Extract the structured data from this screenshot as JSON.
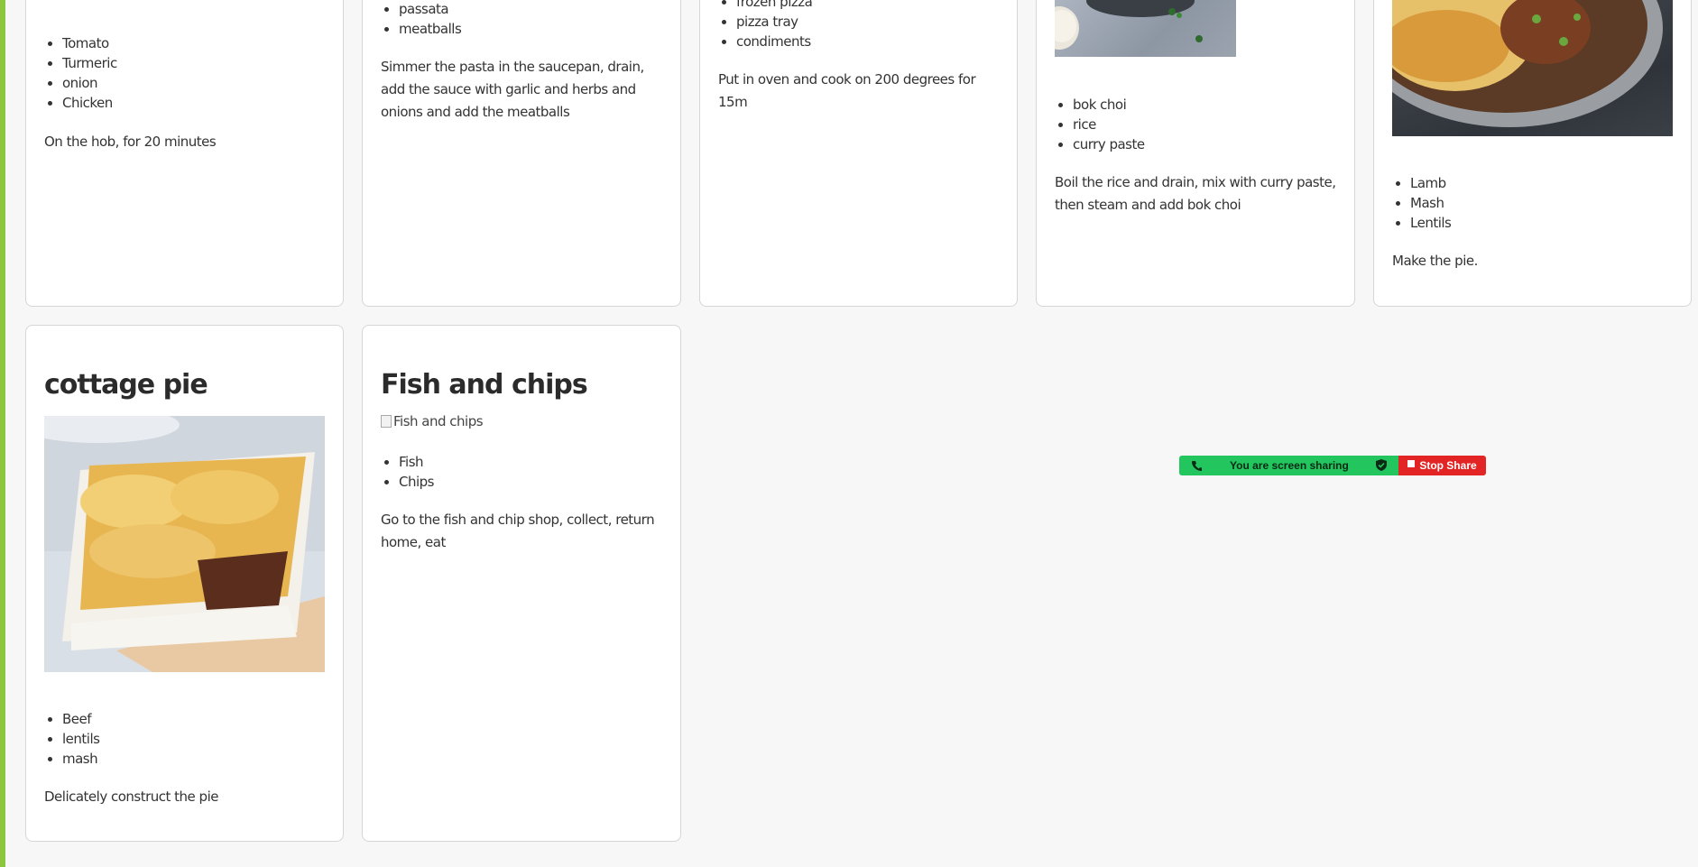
{
  "share_bar": {
    "message": "You are screen sharing",
    "stop_label": "Stop Share",
    "colors": {
      "green": "#22c55e",
      "red": "#e22424"
    }
  },
  "recipes": [
    {
      "title": "",
      "ingredients": [
        "Tomato",
        "Turmeric",
        "onion",
        "Chicken"
      ],
      "method": "On the hob, for 20 minutes"
    },
    {
      "title": "",
      "ingredients": [
        "passata",
        "meatballs"
      ],
      "method": "Simmer the pasta in the saucepan, drain, add the sauce with garlic and herbs and onions and add the meatballs"
    },
    {
      "title": "",
      "ingredients": [
        "frozen pizza",
        "pizza tray",
        "condiments"
      ],
      "method": "Put in oven and cook on 200 degrees for 15m"
    },
    {
      "title": "",
      "ingredients": [
        "bok choi",
        "rice",
        "curry paste"
      ],
      "method": "Boil the rice and drain, mix with curry paste, then steam and add bok choi"
    },
    {
      "title": "",
      "ingredients": [
        "Lamb",
        "Mash",
        "Lentils"
      ],
      "method": "Make the pie."
    },
    {
      "title": "cottage pie",
      "ingredients": [
        "Beef",
        "lentils",
        "mash"
      ],
      "method": "Delicately construct the pie"
    },
    {
      "title": "Fish and chips",
      "image_alt": "Fish and chips",
      "ingredients": [
        "Fish",
        "Chips"
      ],
      "method": "Go to the fish and chip shop, collect, return home, eat"
    }
  ]
}
